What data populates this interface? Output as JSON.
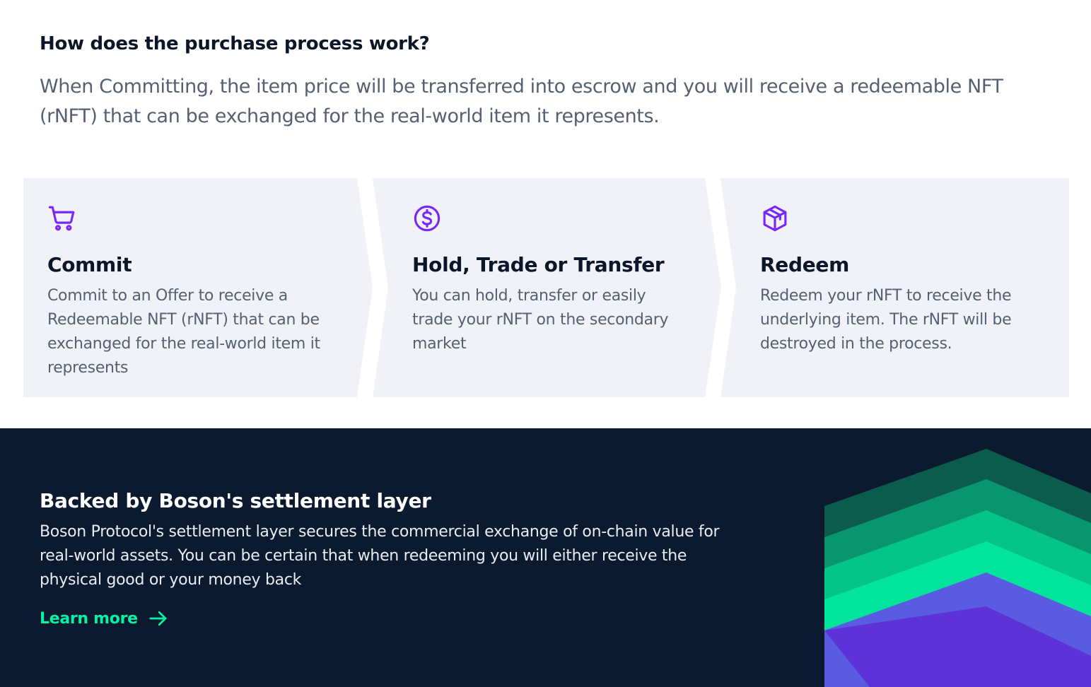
{
  "process": {
    "title": "How does the purchase process work?",
    "intro": "When Committing, the item price will be transferred into escrow and you will receive a redeemable NFT (rNFT) that can be exchanged for the real-world item it represents."
  },
  "steps": [
    {
      "icon": "shopping-cart-icon",
      "title": "Commit",
      "text": "Commit to an Offer to receive a Redeemable NFT (rNFT) that can be exchanged for the real-world item it represents"
    },
    {
      "icon": "dollar-coin-icon",
      "title": "Hold, Trade or Transfer",
      "text": "You can  hold, transfer or easily trade your rNFT on the secondary market"
    },
    {
      "icon": "package-icon",
      "title": "Redeem",
      "text": "Redeem your rNFT to receive the underlying item. The rNFT will be destroyed in the process."
    }
  ],
  "settlement": {
    "title": "Backed by Boson's settlement layer",
    "text": "Boson Protocol's settlement layer secures the commercial exchange of on-chain value for real-world assets. You can be certain that when redeeming you will either receive the physical good or your money back",
    "link_label": "Learn more",
    "link_icon": "arrow-right-icon"
  },
  "colors": {
    "icon_accent": "#7829f9",
    "link_accent": "#02f3a2",
    "dark_background": "#0b1a2e",
    "card_background": "#f1f2f7"
  }
}
